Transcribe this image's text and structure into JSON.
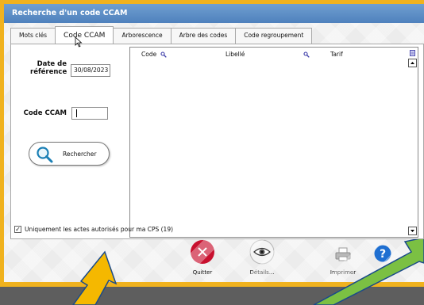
{
  "window": {
    "title": "Recherche d'un code CCAM"
  },
  "tabs": [
    "Mots clés",
    "Code CCAM",
    "Arborescence",
    "Arbre des codes",
    "Code regroupement"
  ],
  "form": {
    "date_label_line1": "Date de",
    "date_label_line2": "référence",
    "date_value": "30/08/2023",
    "code_label": "Code CCAM",
    "code_value": "",
    "search_button": "Rechercher"
  },
  "grid": {
    "columns": [
      "Code",
      "Libellé",
      "Tarif"
    ]
  },
  "filter": {
    "label": "Uniquement les actes autorisés pour ma CPS (19)",
    "checked": true
  },
  "actions": {
    "quit": "Quitter",
    "details": "Détails...",
    "print": "Imprimer"
  },
  "icons": [
    "search-icon",
    "close-icon",
    "eye-icon",
    "printer-icon",
    "help-icon",
    "filter-icon",
    "scroll-up-icon",
    "scroll-down-icon",
    "mouse-cursor-icon"
  ],
  "colors": {
    "frame": "#f0b21e",
    "titlebar": "#4f81bd",
    "quit": "#c8102e",
    "help": "#1f6fd1",
    "arrow_yellow": "#f5b800",
    "arrow_green": "#7bc043"
  }
}
